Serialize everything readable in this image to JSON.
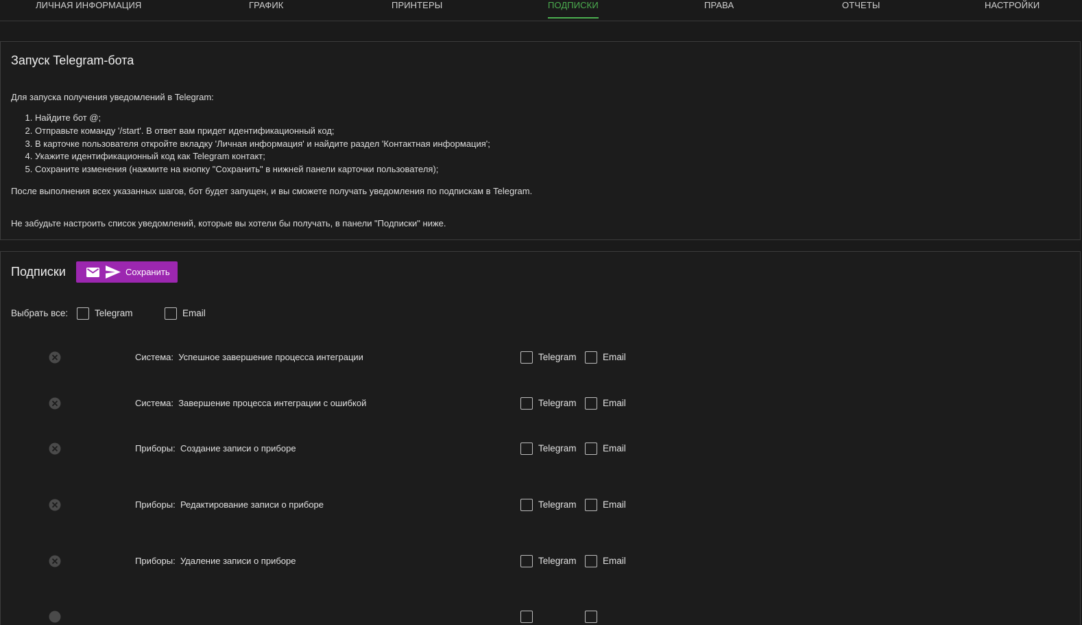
{
  "nav": {
    "tabs": [
      {
        "label": "ЛИЧНАЯ ИНФОРМАЦИЯ"
      },
      {
        "label": "ГРАФИК"
      },
      {
        "label": "ПРИНТЕРЫ"
      },
      {
        "label": "ПОДПИСКИ",
        "active": true
      },
      {
        "label": "ПРАВА"
      },
      {
        "label": "ОТЧЕТЫ"
      },
      {
        "label": "НАСТРОЙКИ"
      }
    ]
  },
  "bot_panel": {
    "title": "Запуск Telegram-бота",
    "intro": "Для запуска получения уведомлений в Telegram:",
    "steps": [
      "Найдите бот @;",
      "Отправьте команду '/start'. В ответ вам придет идентификационный код;",
      "В карточке пользователя откройте вкладку 'Личная информация' и найдите раздел 'Контактная информация';",
      "Укажите идентификационный код как Telegram контакт;",
      "Сохраните изменения (нажмите на кнопку \"Сохранить\" в нижней панели карточки пользователя);"
    ],
    "after": "После выполнения всех указанных шагов, бот будет запущен, и вы сможете получать уведомления по подпискам в Telegram.",
    "reminder": "Не забудьте настроить список уведомлений, которые вы хотели бы получать, в панели \"Подписки\" ниже."
  },
  "subs_panel": {
    "title": "Подписки",
    "save_label": "Сохранить",
    "select_all_label": "Выбрать все:",
    "telegram_label": "Telegram",
    "email_label": "Email",
    "rows": [
      {
        "category": "Система:",
        "name": "Успешное завершение процесса интеграции"
      },
      {
        "category": "Система:",
        "name": "Завершение процесса интеграции с ошибкой"
      },
      {
        "category": "Приборы:",
        "name": "Создание записи о приборе"
      },
      {
        "category": "Приборы:",
        "name": "Редактирование записи о приборе"
      },
      {
        "category": "Приборы:",
        "name": "Удаление записи о приборе"
      },
      {
        "category": "",
        "name": ""
      }
    ]
  },
  "colors": {
    "accent_green": "#4caf50",
    "button_purple": "#9c27b0",
    "background": "#1a1a1a"
  }
}
